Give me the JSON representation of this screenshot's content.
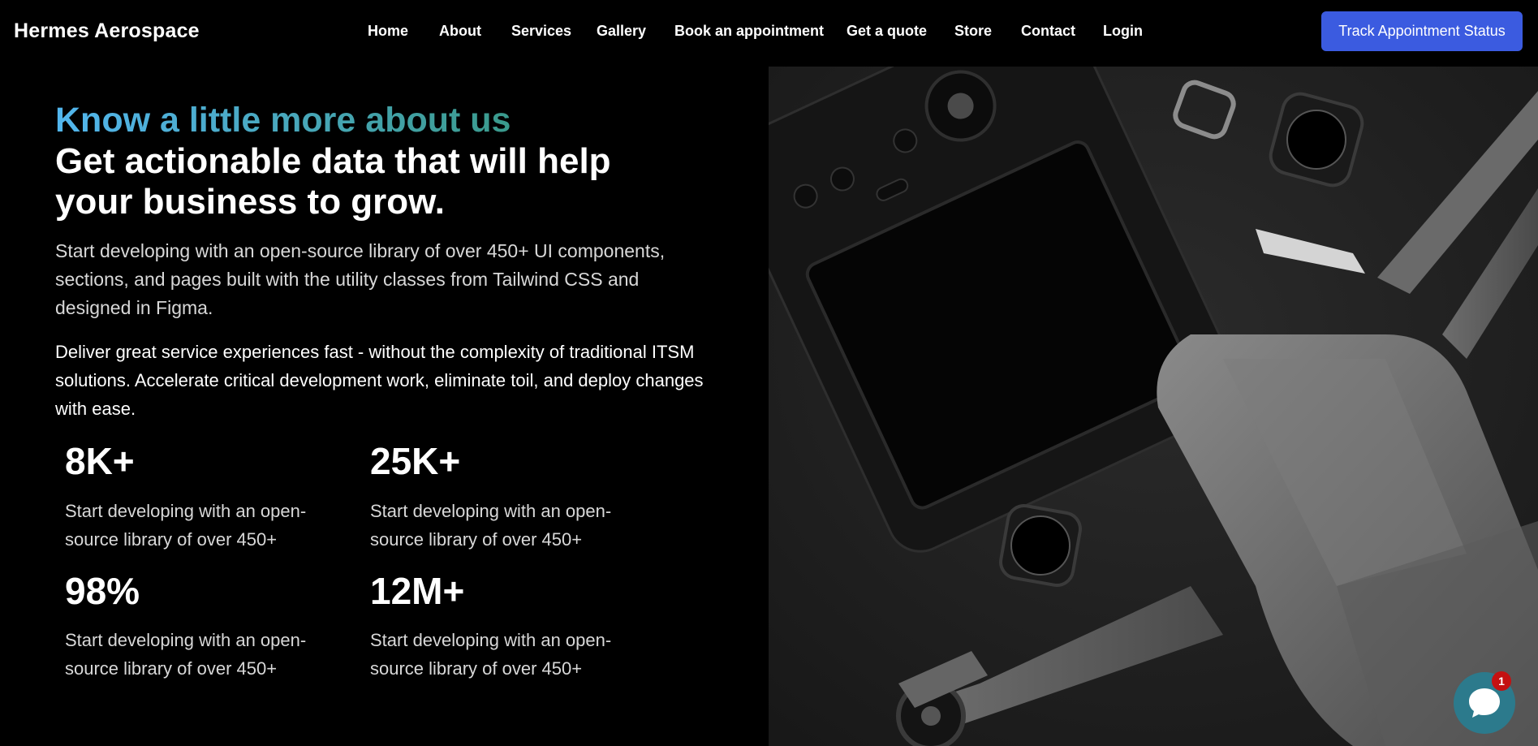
{
  "header": {
    "brand": "Hermes Aerospace",
    "nav": [
      "Home",
      "About",
      "Services",
      "Gallery",
      "Book an appointment",
      "Get a quote",
      "Store",
      "Contact",
      "Login"
    ],
    "cta_label": "Track Appointment Status"
  },
  "hero": {
    "eyebrow": "Know a little more about us",
    "headline": "Get actionable data that will help your business to grow.",
    "lead": "Start developing with an open-source library of over 450+ UI components, sections, and pages built with the utility classes from Tailwind CSS and designed in Figma.",
    "body": "Deliver great service experiences fast - without the complexity of traditional ITSM solutions. Accelerate critical development work, eliminate toil, and deploy changes with ease.",
    "stats": [
      {
        "value": "8K+",
        "desc": "Start developing with an open-source library of over 450+"
      },
      {
        "value": "25K+",
        "desc": "Start developing with an open-source library of over 450+"
      },
      {
        "value": "98%",
        "desc": "Start developing with an open-source library of over 450+"
      },
      {
        "value": "12M+",
        "desc": "Start developing with an open-source library of over 450+"
      }
    ]
  },
  "chat": {
    "badge": "1"
  },
  "colors": {
    "cta": "#3b5be0",
    "chat": "#2c7a8c",
    "badge": "#c41111"
  }
}
